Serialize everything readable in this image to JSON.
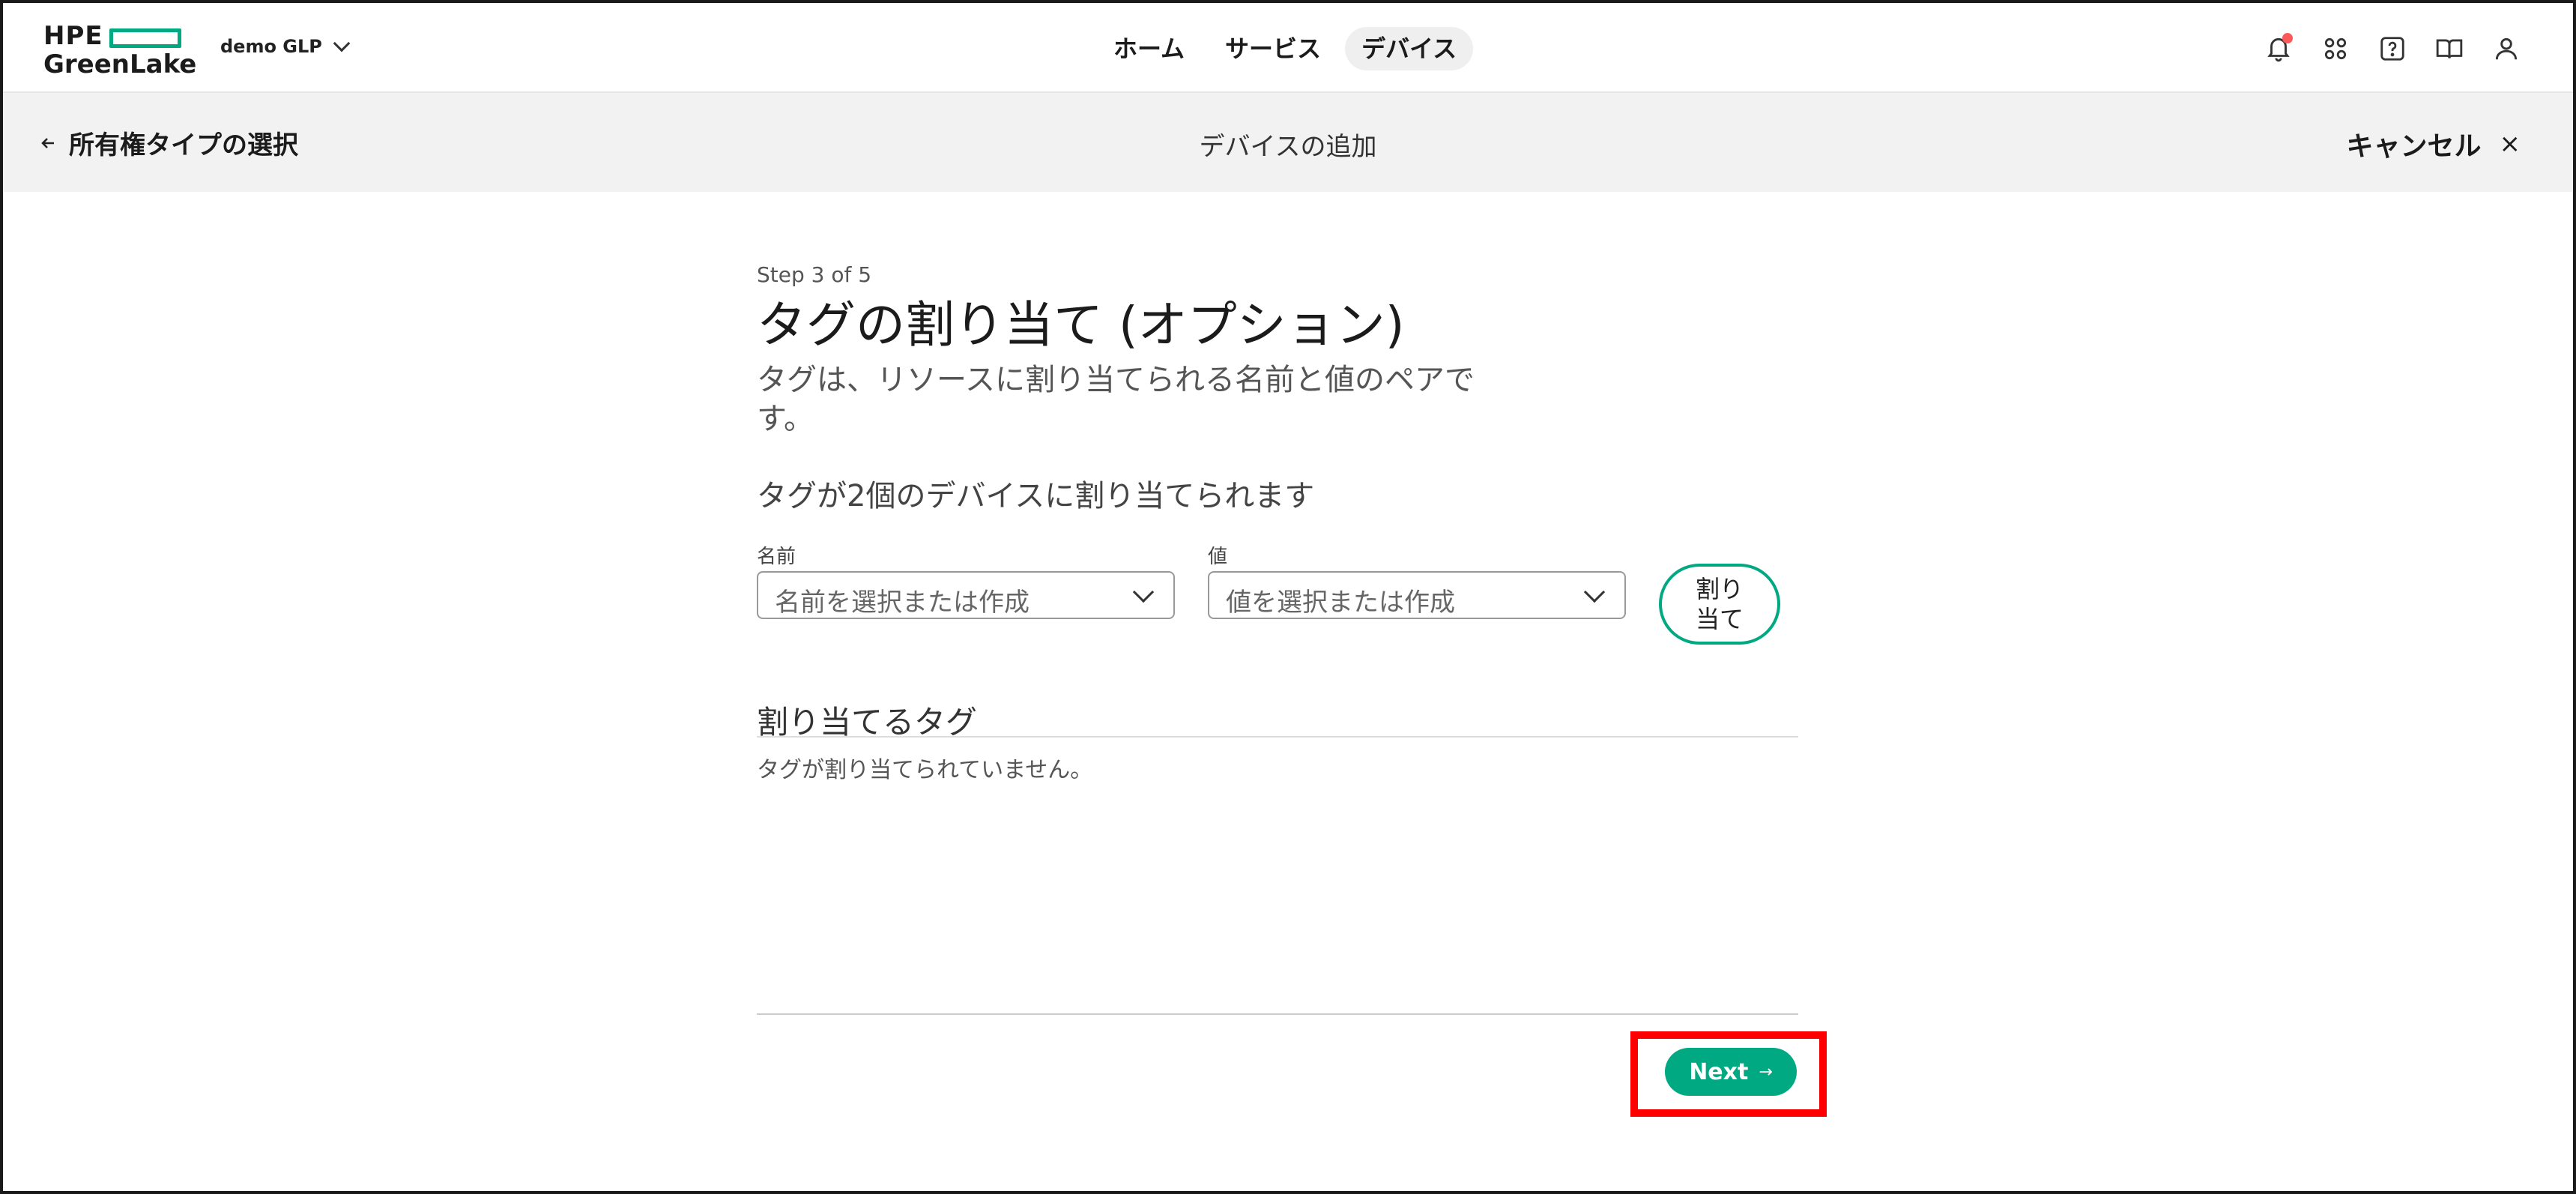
{
  "header": {
    "logo": {
      "line1": "HPE",
      "line2": "GreenLake"
    },
    "workspace": "demo GLP",
    "nav": [
      {
        "label": "ホーム",
        "active": false
      },
      {
        "label": "サービス",
        "active": false
      },
      {
        "label": "デバイス",
        "active": true
      }
    ],
    "utility_icons": [
      "bell-icon",
      "apps-grid-icon",
      "help-icon",
      "book-icon",
      "user-icon"
    ]
  },
  "subheader": {
    "back_label": "所有権タイプの選択",
    "title": "デバイスの追加",
    "cancel_label": "キャンセル",
    "cancel_icon": "×"
  },
  "main": {
    "step": "Step 3 of 5",
    "title": "タグの割り当て (オプション)",
    "description": "タグは、リソースに割り当てられる名前と値のペアです。",
    "note": "タグが2個のデバイスに割り当てられます",
    "name_field": {
      "label": "名前",
      "placeholder": "名前を選択または作成"
    },
    "value_field": {
      "label": "値",
      "placeholder": "値を選択または作成"
    },
    "assign_button": {
      "line1": "割り",
      "line2": "当て"
    },
    "assigned_section": {
      "title": "割り当てるタグ",
      "empty_text": "タグが割り当てられていません。"
    },
    "next_button": {
      "label": "Next",
      "arrow": "→"
    }
  },
  "colors": {
    "brand": "#01a982",
    "highlight": "#ff0000",
    "notification": "#fc5a5a"
  }
}
